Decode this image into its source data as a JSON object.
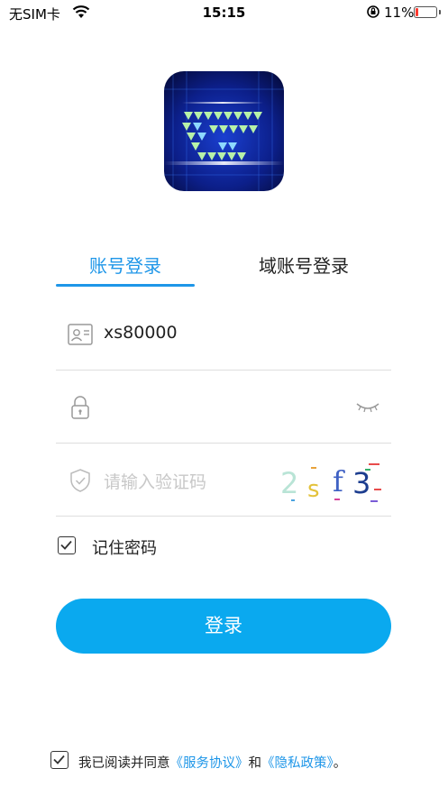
{
  "status_bar": {
    "carrier": "无SIM卡",
    "time": "15:15",
    "battery_percent": "11%",
    "battery_level": 0.11
  },
  "tabs": [
    {
      "label": "账号登录",
      "active": true
    },
    {
      "label": "域账号登录",
      "active": false
    }
  ],
  "form": {
    "username_value": "xs80000",
    "password_value": "",
    "captcha_placeholder": "请输入验证码",
    "captcha_text": "2sf3",
    "remember_label": "记住密码",
    "remember_checked": true
  },
  "login_button": "登录",
  "agreement": {
    "prefix": "我已阅读并同意",
    "service": "《服务协议》",
    "and": "和",
    "privacy": "《隐私政策》",
    "suffix": "。",
    "checked": true
  },
  "colors": {
    "accent": "#1e96e8",
    "button": "#0aa9ef"
  }
}
